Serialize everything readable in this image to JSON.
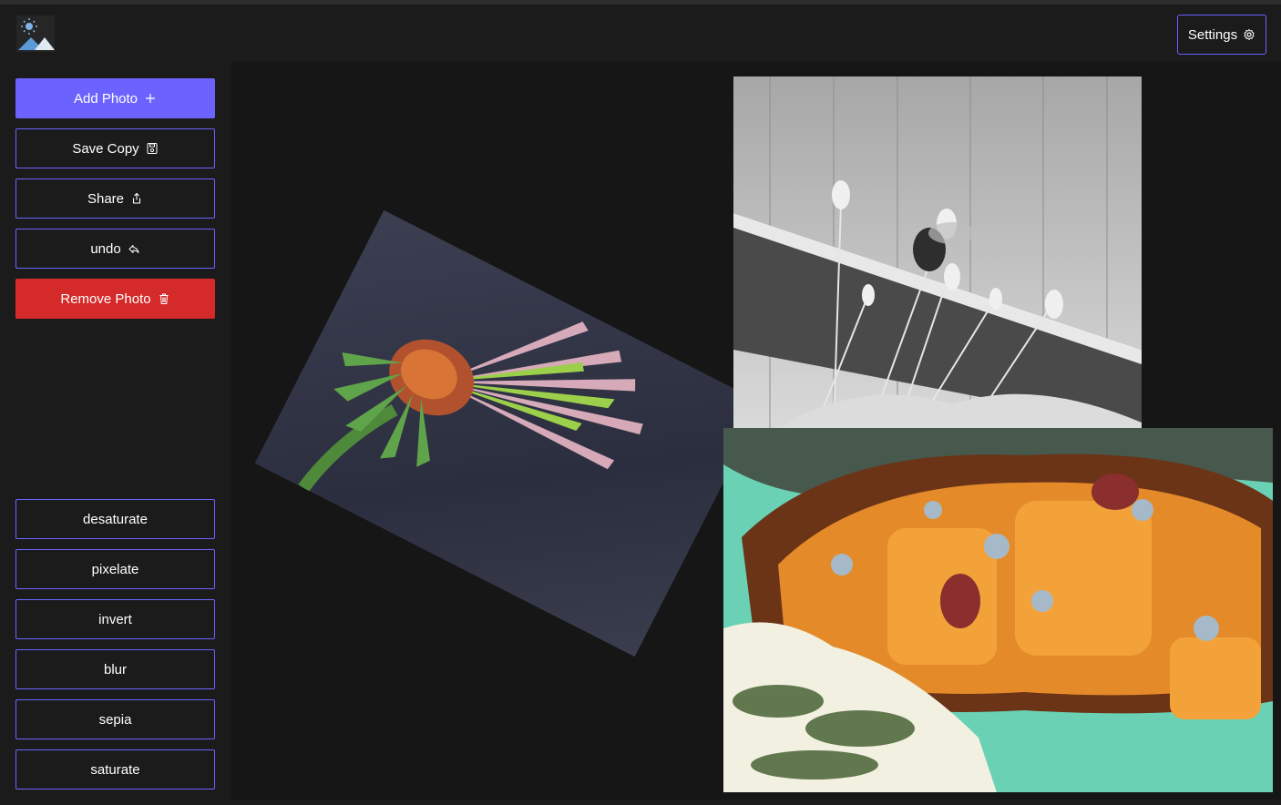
{
  "app": {
    "logo_icon": "image-sun-mountain-icon",
    "accent": "#6c63ff",
    "danger": "#d42a2a"
  },
  "header": {
    "settings_label": "Settings",
    "settings_icon": "gear-icon"
  },
  "sidebar": {
    "actions": [
      {
        "label": "Add Photo",
        "icon": "plus-icon"
      },
      {
        "label": "Save Copy",
        "icon": "save-icon"
      },
      {
        "label": "Share",
        "icon": "share-icon"
      },
      {
        "label": "undo",
        "icon": "undo-icon"
      },
      {
        "label": "Remove Photo",
        "icon": "trash-icon"
      }
    ],
    "filters": [
      {
        "label": "desaturate"
      },
      {
        "label": "pixelate"
      },
      {
        "label": "invert"
      },
      {
        "label": "blur"
      },
      {
        "label": "sepia"
      },
      {
        "label": "saturate"
      }
    ]
  },
  "canvas": {
    "photos": [
      {
        "subject": "coneflower",
        "rotation_deg": 27
      },
      {
        "subject": "lavender-and-bee",
        "filter": "desaturate"
      },
      {
        "subject": "roasted-squash"
      }
    ]
  }
}
